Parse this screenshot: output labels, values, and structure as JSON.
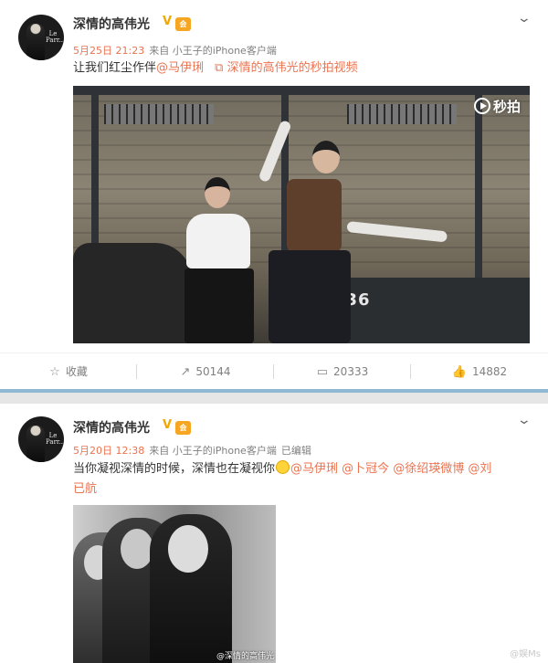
{
  "posts": [
    {
      "avatar_text": "Le\nParr...",
      "username": "深情的高伟光",
      "verified_badge": "V",
      "level_badge": "会",
      "menu_icon": "chevron-down-icon",
      "time": "5月25日 21:23",
      "source": "来自 小王子的iPhone客户端",
      "edited": "",
      "text_plain": "让我们红尘作伴",
      "mention": "@马伊琍",
      "video_link_icon": "video-icon",
      "video_link": "深情的高伟光的秒拍视频",
      "video_plate": "-36",
      "video_logo": "秒拍"
    },
    {
      "avatar_text": "Le\nParr...",
      "username": "深情的高伟光",
      "verified_badge": "V",
      "level_badge": "会",
      "menu_icon": "chevron-down-icon",
      "time": "5月20日 12:38",
      "source": "来自 小王子的iPhone客户端",
      "edited": "已编辑",
      "text_line1_plain": "当你凝视深情的时候，深情也在凝视你",
      "emoji": "smile-emoji",
      "mentions_line1": "@马伊琍 @卜冠今 @徐绍瑛微博 @刘",
      "mentions_line2": "已航",
      "photo_watermark": "@深情的高伟光"
    }
  ],
  "actions": [
    {
      "icon": "star-icon",
      "glyph": "☆",
      "label": "收藏"
    },
    {
      "icon": "share-icon",
      "glyph": "↗",
      "label": "50144"
    },
    {
      "icon": "comment-icon",
      "glyph": "▭",
      "label": "20333"
    },
    {
      "icon": "like-icon",
      "glyph": "👍",
      "label": "14882"
    }
  ],
  "footer_watermark": "@娱Ms",
  "colors": {
    "mention": "#eb7350",
    "meta": "#808080",
    "divider_accent": "#8fb9d3",
    "badge": "#f6a623"
  }
}
